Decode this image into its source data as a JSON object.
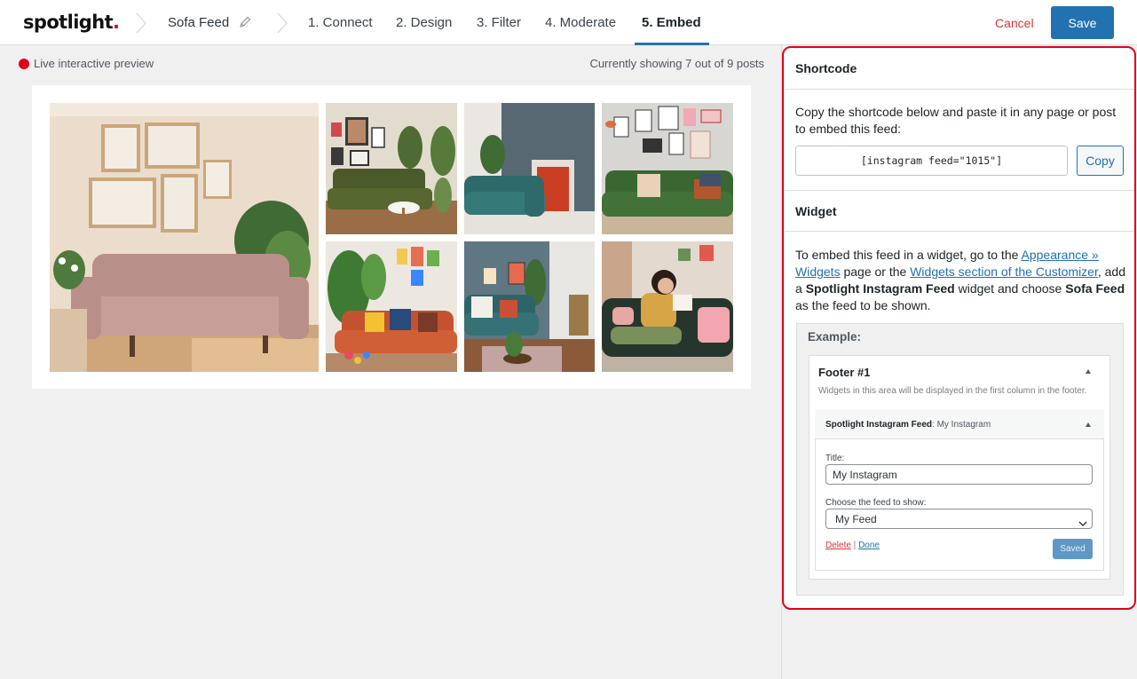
{
  "header": {
    "logo_text": "spotlight",
    "logo_dot": ".",
    "feed_name": "Sofa Feed",
    "steps": [
      {
        "label": "1. Connect",
        "active": false
      },
      {
        "label": "2. Design",
        "active": false
      },
      {
        "label": "3. Filter",
        "active": false
      },
      {
        "label": "4. Moderate",
        "active": false
      },
      {
        "label": "5. Embed",
        "active": true
      }
    ],
    "cancel_label": "Cancel",
    "save_label": "Save"
  },
  "preview": {
    "live_label": "Live interactive preview",
    "showing_text": "Currently showing 7 out of 9 posts",
    "photos": [
      {
        "name": "photo-pink-sofa",
        "icon": "sofa-photo"
      },
      {
        "name": "photo-green-sofa-gallery",
        "icon": "sofa-photo"
      },
      {
        "name": "photo-teal-sofa-fireplace",
        "icon": "sofa-photo"
      },
      {
        "name": "photo-green-sofa-frames",
        "icon": "sofa-photo"
      },
      {
        "name": "photo-orange-sofa-plants",
        "icon": "sofa-photo"
      },
      {
        "name": "photo-teal-sofa-room",
        "icon": "sofa-photo"
      },
      {
        "name": "photo-woman-reading-sofa",
        "icon": "sofa-photo"
      }
    ]
  },
  "sidebar": {
    "shortcode": {
      "heading": "Shortcode",
      "description": "Copy the shortcode below and paste it in any page or post to embed this feed:",
      "code": "[instagram feed=\"1015\"]",
      "copy_label": "Copy"
    },
    "widget": {
      "heading": "Widget",
      "desc_part1": "To embed this feed in a widget, go to the ",
      "link_appearance": "Appearance » Widgets",
      "desc_part2": " page or the ",
      "link_customizer": "Widgets section of the Customizer",
      "desc_part3": ", add a ",
      "widget_name": "Spotlight Instagram Feed",
      "desc_part4": " widget and choose ",
      "feed_name": "Sofa Feed",
      "desc_part5": " as the feed to be shown."
    },
    "example": {
      "label": "Example:",
      "footer_title": "Footer #1",
      "footer_desc": "Widgets in this area will be displayed in the first column in the footer.",
      "widget_title_bold": "Spotlight Instagram Feed",
      "widget_title_rest": ": My Instagram",
      "title_label": "Title:",
      "title_value": "My Instagram",
      "feed_label": "Choose the feed to show:",
      "feed_value": "My Feed",
      "delete_label": "Delete",
      "separator": " | ",
      "done_label": "Done",
      "saved_label": "Saved"
    }
  },
  "colors": {
    "accent": "#2271b1",
    "danger": "#d63638",
    "highlight": "#e0001b"
  }
}
